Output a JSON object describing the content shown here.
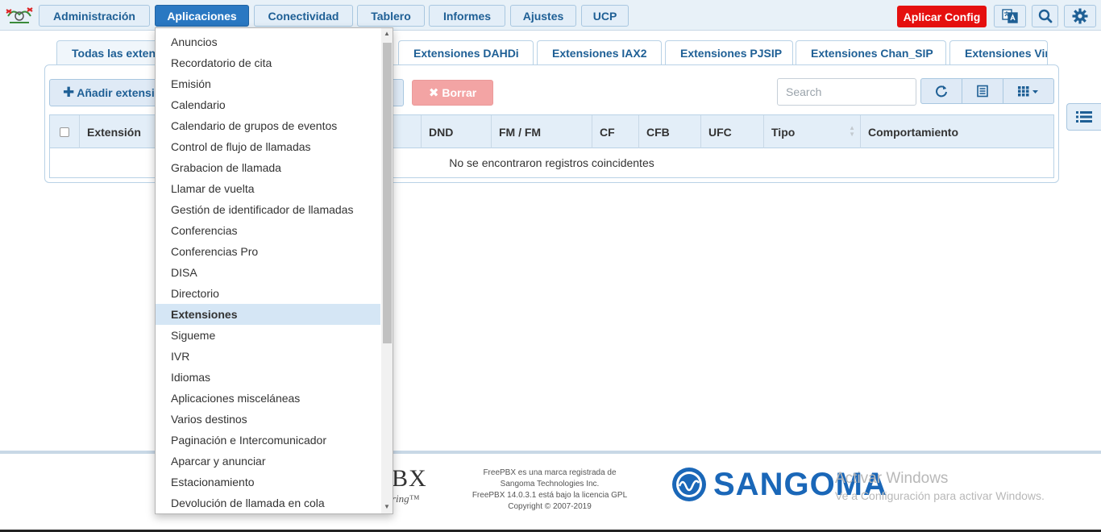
{
  "nav": {
    "items": [
      {
        "label": "Administración"
      },
      {
        "label": "Aplicaciones"
      },
      {
        "label": "Conectividad"
      },
      {
        "label": "Tablero"
      },
      {
        "label": "Informes"
      },
      {
        "label": "Ajustes"
      },
      {
        "label": "UCP"
      }
    ],
    "apply_label": "Aplicar Config"
  },
  "tabs": [
    {
      "label": "Todas las extensiones"
    },
    {
      "label": "Extensiones DAHDi"
    },
    {
      "label": "Extensiones IAX2"
    },
    {
      "label": "Extensiones PJSIP"
    },
    {
      "label": "Extensiones Chan_SIP"
    },
    {
      "label": "Extensiones Virtuales"
    }
  ],
  "toolbar": {
    "add_label": "Añadir extensión",
    "delete_label": "Borrar",
    "search_placeholder": "Search"
  },
  "table": {
    "columns": [
      "Extensión",
      "DND",
      "FM / FM",
      "CF",
      "CFB",
      "UFC",
      "Tipo",
      "Comportamiento"
    ],
    "empty_message": "No se encontraron registros coincidentes"
  },
  "dropdown": {
    "items": [
      "Anuncios",
      "Recordatorio de cita",
      "Emisión",
      "Calendario",
      "Calendario de grupos de eventos",
      "Control de flujo de llamadas",
      "Grabacion de llamada",
      "Llamar de vuelta",
      "Gestión de identificador de llamadas",
      "Conferencias",
      "Conferencias Pro",
      "DISA",
      "Directorio",
      "Extensiones",
      "Sigueme",
      "IVR",
      "Idiomas",
      "Aplicaciones misceláneas",
      "Varios destinos",
      "Paginación e Intercomunicador",
      "Aparcar y anunciar",
      "Estacionamiento",
      "Devolución de llamada en cola"
    ],
    "selected": "Extensiones"
  },
  "footer": {
    "brand_fragment": "BX",
    "tagline_fragment": "ring™",
    "legal_lines": [
      "FreePBX es una marca registrada de",
      "Sangoma Technologies Inc.",
      "FreePBX 14.0.3.1 está bajo la licencia GPL",
      "Copyright © 2007-2019"
    ],
    "sangoma": "SANGOMA",
    "watermark_title": "Activar Windows",
    "watermark_sub": "Ve a Configuración para activar Windows."
  },
  "colors": {
    "accent": "#2a78c2",
    "apply": "#e5100f",
    "delete": "#f3a4a4",
    "sangoma": "#1a67b8"
  }
}
